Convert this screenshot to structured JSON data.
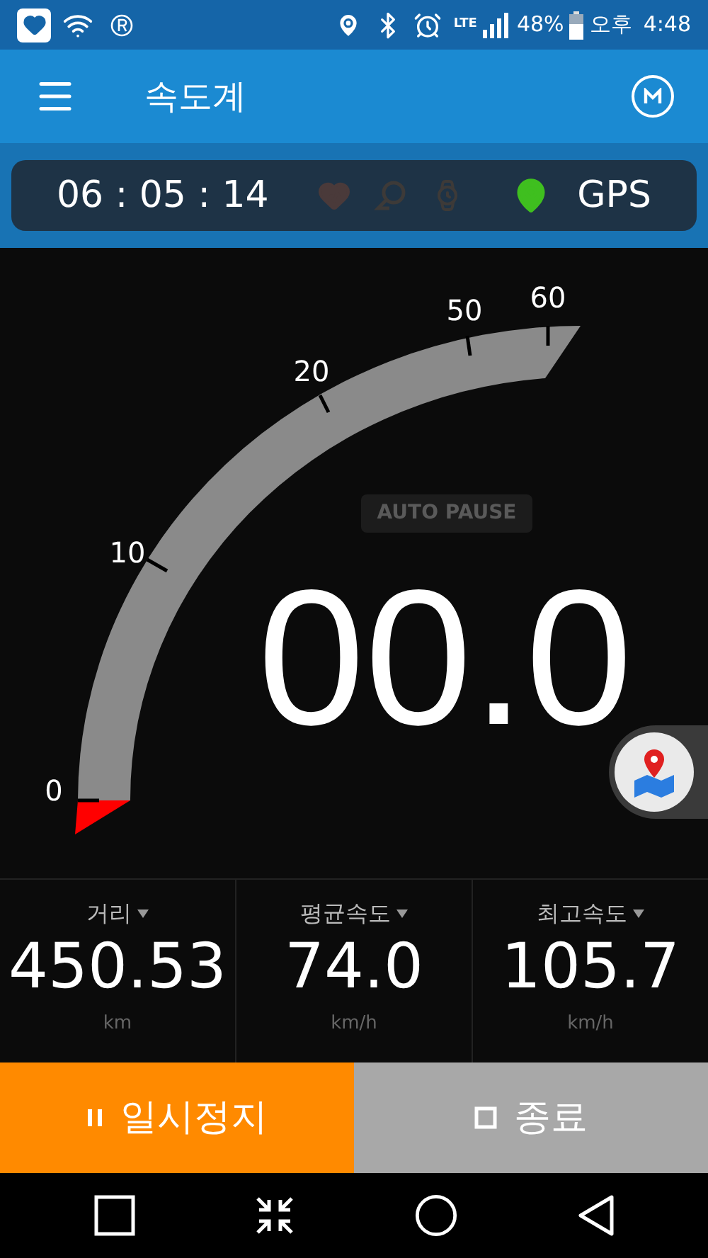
{
  "status_bar": {
    "network": "LTE",
    "battery": "48%",
    "ampm": "오후",
    "time": "4:48"
  },
  "header": {
    "title": "속도계"
  },
  "timer": {
    "elapsed": "06 : 05 : 14",
    "gps_label": "GPS"
  },
  "gauge": {
    "ticks": [
      "0",
      "10",
      "20",
      "50",
      "60"
    ],
    "status": "AUTO PAUSE",
    "speed": "00.0"
  },
  "stats": [
    {
      "label": "거리",
      "value": "450.53",
      "unit": "km"
    },
    {
      "label": "평균속도",
      "value": "74.0",
      "unit": "km/h"
    },
    {
      "label": "최고속도",
      "value": "105.7",
      "unit": "km/h"
    }
  ],
  "buttons": [
    {
      "kind": "pause",
      "label": "일시정지"
    },
    {
      "kind": "stop",
      "label": "종료"
    }
  ]
}
